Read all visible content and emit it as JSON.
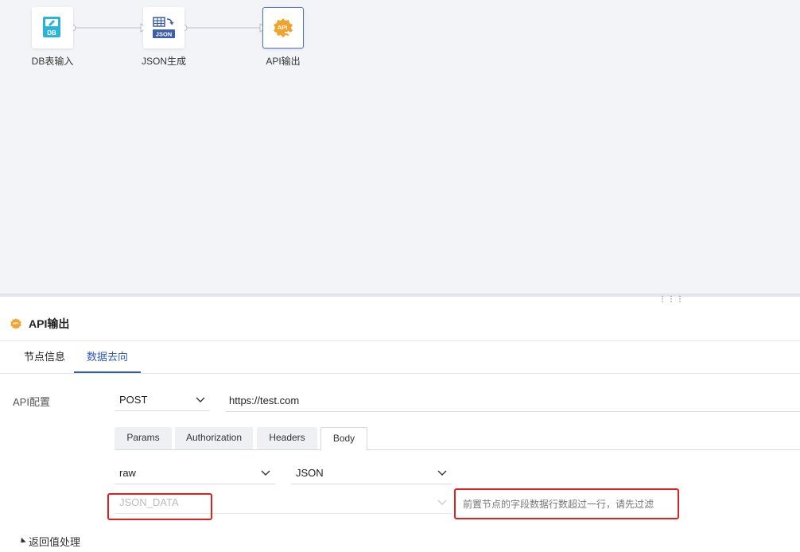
{
  "canvas": {
    "nodes": [
      {
        "label": "DB表输入",
        "icon": "db-table-icon",
        "badge": "DB",
        "color": "#2bb3d8"
      },
      {
        "label": "JSON生成",
        "icon": "json-generate-icon",
        "badge": "JSON",
        "color": "#3d5ea8"
      },
      {
        "label": "API输出",
        "icon": "api-output-icon",
        "badge": "API",
        "color": "#f0a430"
      }
    ]
  },
  "panel": {
    "title": "API输出",
    "icon": "api-output-icon",
    "tabs": [
      {
        "label": "节点信息",
        "active": false
      },
      {
        "label": "数据去向",
        "active": true
      }
    ]
  },
  "form": {
    "api_label": "API配置",
    "method": "POST",
    "url": "https://test.com",
    "subtabs": [
      {
        "label": "Params",
        "active": false
      },
      {
        "label": "Authorization",
        "active": false
      },
      {
        "label": "Headers",
        "active": false
      },
      {
        "label": "Body",
        "active": true
      }
    ],
    "body_type": "raw",
    "content_type": "JSON",
    "field_placeholder": "JSON_DATA",
    "hint": "前置节点的字段数据行数超过一行，请先过滤",
    "return_section": "返回值处理"
  },
  "colors": {
    "accent": "#2f5bb7",
    "highlight": "#e02020"
  }
}
